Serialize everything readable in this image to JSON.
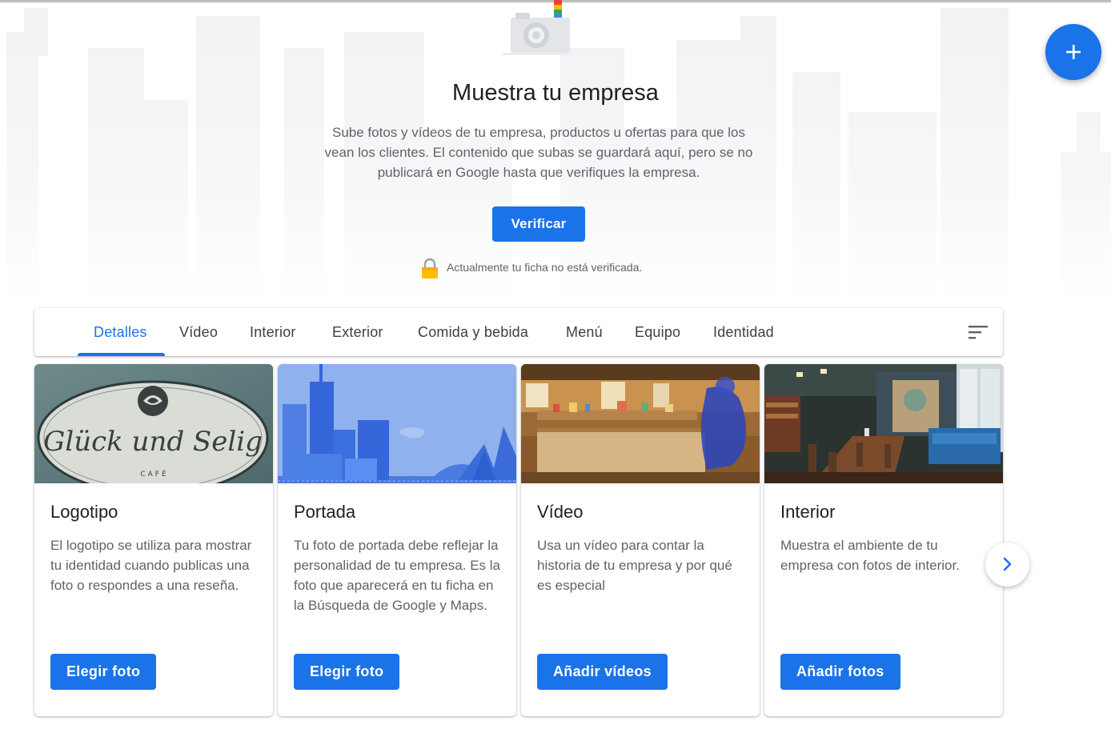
{
  "hero": {
    "title": "Muestra tu empresa",
    "description": "Sube fotos y vídeos de tu empresa, productos u ofertas para que los vean los clientes. El contenido que subas se guardará aquí, pero se no publicará en Google hasta que verifiques la empresa.",
    "verify_label": "Verificar",
    "status_text": "Actualmente tu ficha no está verificada.",
    "icons": {
      "camera": "camera-icon",
      "lock": "lock-icon"
    }
  },
  "fab": {
    "icon": "plus-icon"
  },
  "tabs": [
    {
      "label": "Detalles",
      "active": true
    },
    {
      "label": "Vídeo",
      "active": false
    },
    {
      "label": "Interior",
      "active": false
    },
    {
      "label": "Exterior",
      "active": false
    },
    {
      "label": "Comida y bebida",
      "active": false
    },
    {
      "label": "Menú",
      "active": false
    },
    {
      "label": "Equipo",
      "active": false
    },
    {
      "label": "Identidad",
      "active": false
    }
  ],
  "filter_icon": "sort-icon",
  "cards": [
    {
      "title": "Logotipo",
      "description": "El logotipo se utiliza para mostrar tu identidad cuando publicas una foto o respondes a una reseña.",
      "button": "Elegir foto",
      "image": {
        "kind": "logo",
        "lines": [
          "Glück und Selig",
          "CAFÉ"
        ]
      }
    },
    {
      "title": "Portada",
      "description": "Tu foto de portada debe reflejar la personalidad de tu empresa. Es la foto que aparecerá en tu ficha en la Búsqueda de Google y Maps.",
      "button": "Elegir foto",
      "image": {
        "kind": "cover-illustration"
      }
    },
    {
      "title": "Vídeo",
      "description": "Usa un vídeo para contar la historia de tu empresa y por qué es especial",
      "button": "Añadir vídeos",
      "image": {
        "kind": "shop-interior-photo"
      }
    },
    {
      "title": "Interior",
      "description": "Muestra el ambiente de tu empresa con fotos de interior.",
      "button": "Añadir fotos",
      "image": {
        "kind": "restaurant-interior-photo"
      }
    }
  ],
  "next_icon": "chevron-right-icon",
  "colors": {
    "accent": "#1a73e8",
    "text": "#202124",
    "muted": "#5f6368"
  }
}
